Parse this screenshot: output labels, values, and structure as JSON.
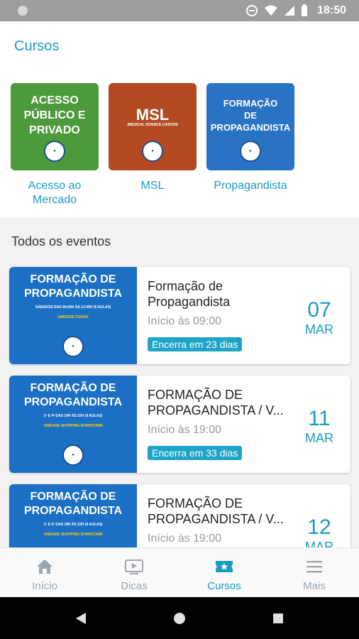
{
  "status_bar": {
    "time": "18:50"
  },
  "sections": {
    "cursos_title": "Cursos",
    "eventos_title": "Todos os eventos"
  },
  "courses": [
    {
      "thumb_title_1": "ACESSO",
      "thumb_title_2": "PÚBLICO E",
      "thumb_title_3": "PRIVADO",
      "label": "Acesso ao Mercado"
    },
    {
      "thumb_title_1": "MSL",
      "thumb_subtitle": "(MEDICAL SCIENCE LIAISON)",
      "label": "MSL"
    },
    {
      "thumb_title_1": "FORMAÇÃO",
      "thumb_title_2": "DE",
      "thumb_title_3": "PROPAGANDISTA",
      "label": "Propagandista"
    }
  ],
  "events": [
    {
      "img_heading": "FORMAÇÃO DE PROPAGANDISTA",
      "img_schedule": "SÁBADOS DAS 09:00H ÀS 13:45H (5 AULAS)",
      "img_unit": "UNIDADE CAXIAS",
      "title": "Formação de Propagandista",
      "start": "Início às 09:00",
      "ends": "Encerra em 23 dias",
      "day": "07",
      "month": "MAR"
    },
    {
      "img_heading": "FORMAÇÃO DE PROPAGANDISTA",
      "img_schedule": "2ª E 4ª DAS 19H ÀS 22H (8 AULAS)",
      "img_unit": "UNIDADE SHOPPING DOWNTOWN",
      "title": "FORMAÇÃO DE PROPAGANDISTA / V...",
      "start": "Início às 19:00",
      "ends": "Encerra em 33 dias",
      "day": "11",
      "month": "MAR"
    },
    {
      "img_heading": "FORMAÇÃO DE PROPAGANDISTA",
      "img_schedule": "3ª E 5ª DAS 19H ÀS 22H (8 AULAS)",
      "img_unit": "UNIDADE SHOPPING DOWNTOWN",
      "title": "FORMAÇÃO DE PROPAGANDISTA / V...",
      "start": "Início às 19:00",
      "day": "12",
      "month": "MAR"
    }
  ],
  "bottom_nav": [
    {
      "label": "Início",
      "icon": "home-icon"
    },
    {
      "label": "Dicas",
      "icon": "tv-play-icon"
    },
    {
      "label": "Cursos",
      "icon": "ticket-star-icon",
      "active": true
    },
    {
      "label": "Mais",
      "icon": "menu-icon"
    }
  ],
  "colors": {
    "accent": "#1a9bbf",
    "pill": "#1ea4c7"
  }
}
